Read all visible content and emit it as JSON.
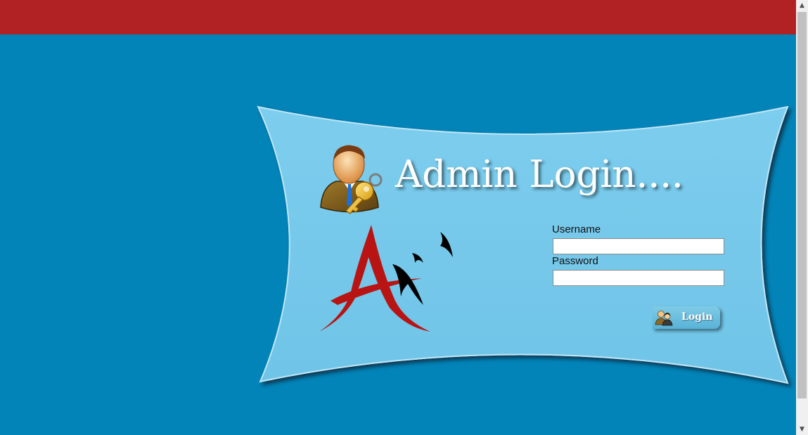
{
  "page": {
    "title": "Admin Login....",
    "colors": {
      "background": "#0284b8",
      "top_bar": "#b02224",
      "panel": "#74c8ea",
      "title_text": "#ffffff",
      "logo_red": "#b81414",
      "logo_black": "#000000"
    }
  },
  "icons": {
    "admin": "admin-key-icon",
    "logo": "brand-logo",
    "login_button": "users-icon"
  },
  "form": {
    "username_label": "Username",
    "username_value": "",
    "password_label": "Password",
    "password_value": "",
    "login_label": "Login"
  }
}
